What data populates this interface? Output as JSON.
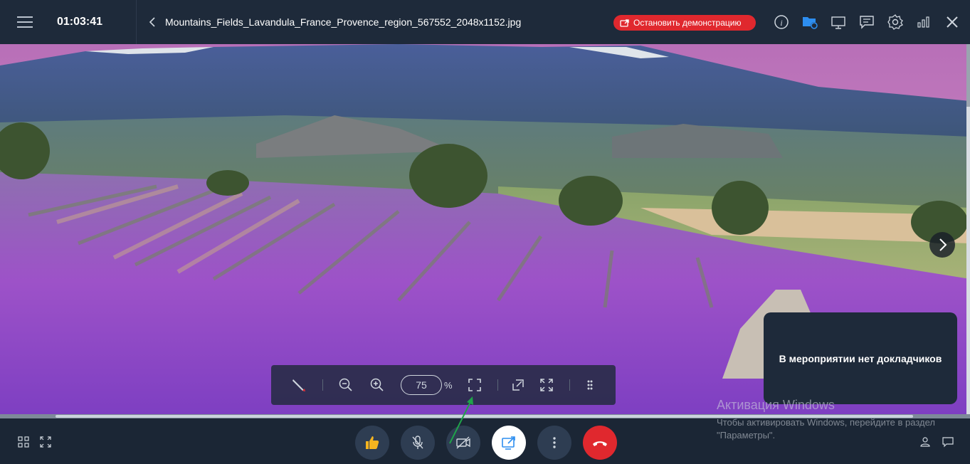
{
  "header": {
    "timer": "01:03:41",
    "file_title": "Mountains_Fields_Lavandula_France_Provence_region_567552_2048x1152.jpg",
    "stop_label": "Остановить демонстрацию",
    "icons": [
      "info-icon",
      "folder-share-icon",
      "whiteboard-icon",
      "chat-bubble-icon",
      "gear-icon",
      "signal-icon",
      "close-icon"
    ]
  },
  "stage": {
    "speakers_text": "В мероприятии нет докладчиков"
  },
  "zoom_toolbar": {
    "zoom_value": "75",
    "percent_sign": "%"
  },
  "windows_watermark": {
    "title": "Активация Windows",
    "text": "Чтобы активировать Windows, перейдите в раздел \"Параметры\"."
  },
  "colors": {
    "topbar": "#1e2a3a",
    "stop_button": "#e0282e",
    "hangup": "#e0282e",
    "bottom_button": "#2e3d52",
    "active_share": "#ffffff",
    "pointer_arrow": "#1fa34a"
  }
}
